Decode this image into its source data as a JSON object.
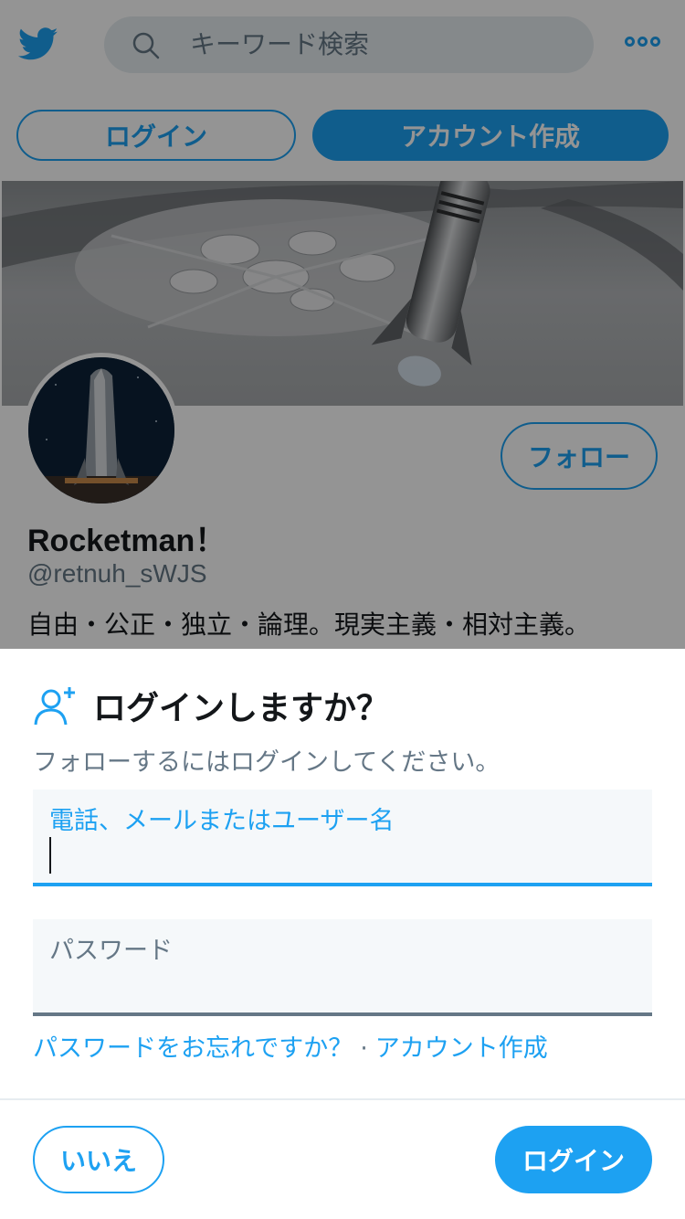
{
  "header": {
    "logo_icon": "twitter-bird-icon",
    "search_placeholder": "キーワード検索",
    "more_icon": "more-dots-icon"
  },
  "auth": {
    "login_label": "ログイン",
    "signup_label": "アカウント作成"
  },
  "profile": {
    "name": "Rocketman！",
    "handle": "@retnuh_sWJS",
    "bio": "自由・公正・独立・論理。現実主義・相対主義。",
    "follow_label": "フォロー"
  },
  "login_prompt": {
    "icon": "add-user-icon",
    "title": "ログインしますか？",
    "subtitle": "フォローするにはログインしてください。",
    "username_label": "電話、メールまたはユーザー名",
    "username_value": "",
    "password_label": "パスワード",
    "password_value": "",
    "forgot_link": "パスワードをお忘れですか？",
    "separator": "·",
    "signup_link": "アカウント作成",
    "no_label": "いいえ",
    "login_label": "ログイン"
  },
  "colors": {
    "accent": "#1da1f2",
    "text": "#14171a",
    "muted": "#657786",
    "field_bg": "#f5f8fa"
  }
}
